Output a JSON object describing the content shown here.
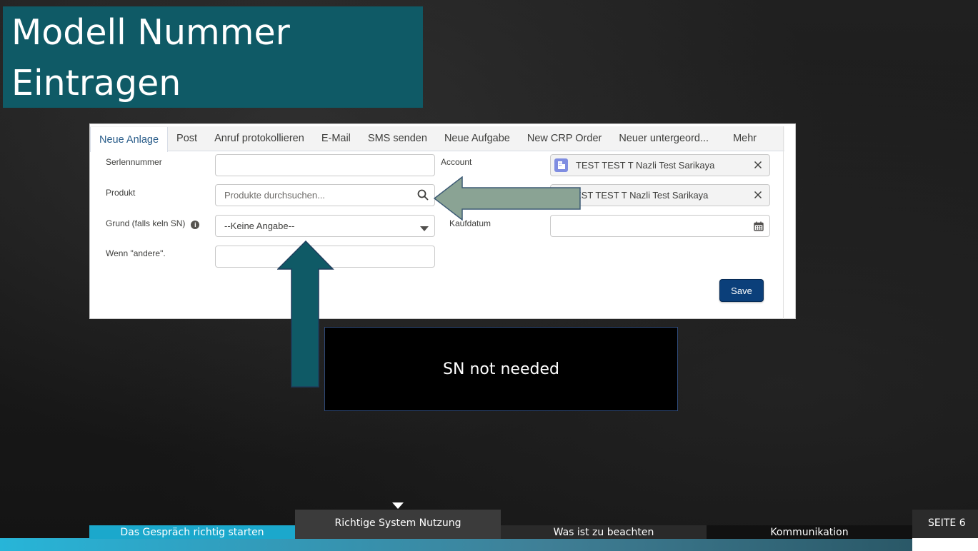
{
  "slide": {
    "title_line1": "Modell Nummer",
    "title_line2": "Eintragen",
    "callout_text": "SN not needed",
    "page_label": "SEITE 6"
  },
  "tabs": [
    "Neue Anlage",
    "Post",
    "Anruf protokollieren",
    "E-Mail",
    "SMS senden",
    "Neue Aufgabe",
    "New CRP Order",
    "Neuer untergeord...",
    "Mehr"
  ],
  "form": {
    "serial_label": "Serlennummer",
    "serial_value": "",
    "product_label": "Produkt",
    "product_placeholder": "Produkte durchsuchen...",
    "reason_label": "Grund (falls keln SN)",
    "reason_value": "--Keine Angabe--",
    "other_label": "Wenn \"andere\".",
    "other_value": "",
    "account_label": "Account",
    "account_value": "TEST TEST T Nazli Test Sarikaya",
    "account2_value": "EST TEST T Nazli Test Sarikaya",
    "purchase_label": "Kaufdatum",
    "purchase_value": "",
    "save_label": "Save"
  },
  "nav": {
    "item1": "Das Gespräch richtig starten",
    "item2": "Richtige System Nutzung",
    "item3": "Was ist zu beachten",
    "item4": "Kommunikation"
  },
  "colors": {
    "title_bg": "#0f5a66",
    "arrow_left": "#8aa394",
    "arrow_up": "#0f5a66",
    "save_bg": "#0b3f7a"
  },
  "icons": [
    "search-icon",
    "dropdown-arrow-icon",
    "calendar-icon",
    "close-icon",
    "account-icon",
    "info-icon"
  ]
}
